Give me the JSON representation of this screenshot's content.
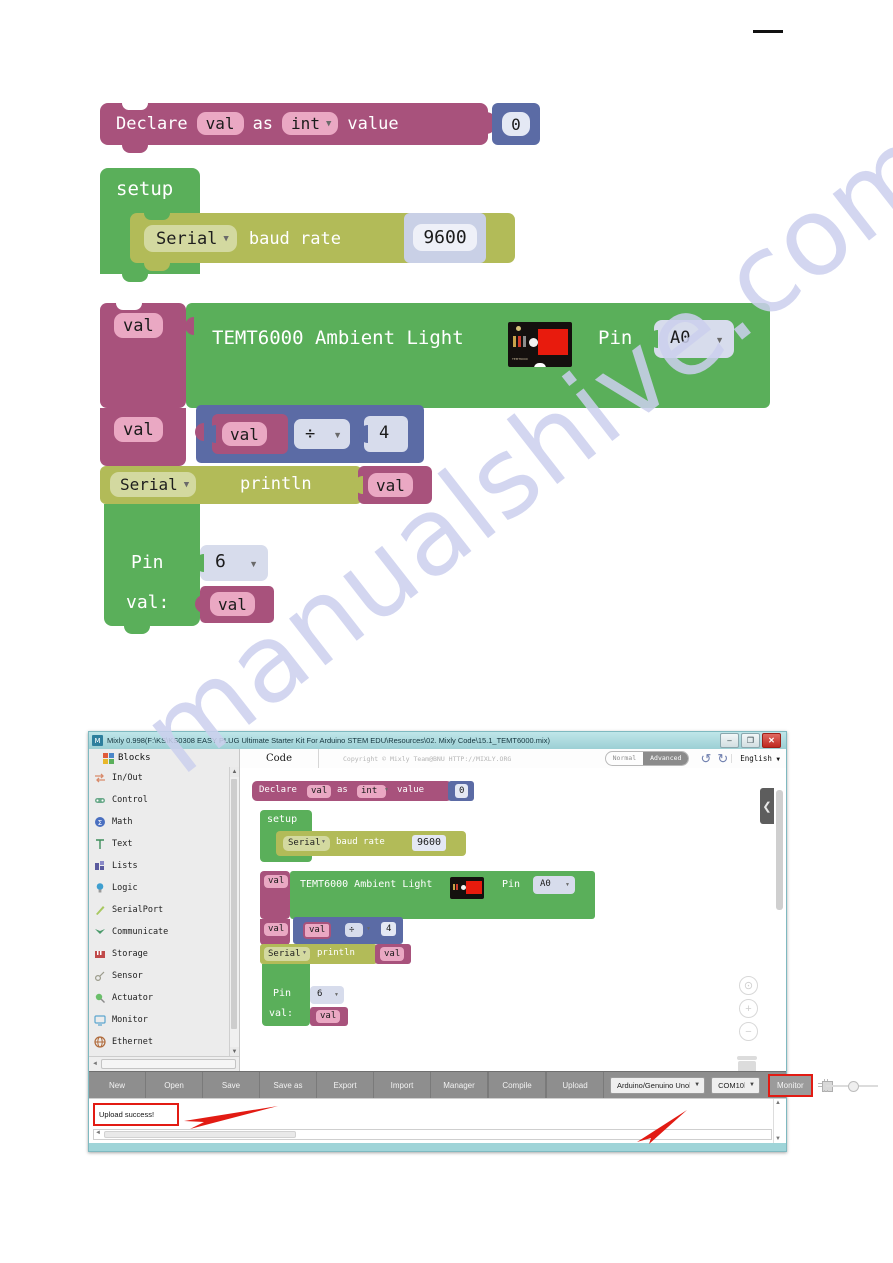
{
  "watermark": "manualshive.com",
  "blocks_diagram": {
    "declare": {
      "label_1": "Declare",
      "var_name": "val",
      "label_2": "as",
      "type": "int",
      "label_3": "value",
      "value": "0"
    },
    "setup": {
      "label": "setup",
      "serial": "Serial",
      "baud_label": "baud rate",
      "baud_value": "9600"
    },
    "sensor_row": {
      "var_name": "val",
      "label": "TEMT6000 Ambient Light",
      "pin_label": "Pin",
      "pin_value": "A0",
      "sensor_silk": "TEMT6000"
    },
    "math_row": {
      "var_name": "val",
      "operand_a": "val",
      "operator": "÷",
      "operand_b": "4"
    },
    "println_row": {
      "serial": "Serial",
      "label": "println",
      "value": "val"
    },
    "analog_row": {
      "pin_label": "Pin",
      "pin_value": "6",
      "val_label": "val:",
      "val_value": "val"
    }
  },
  "app": {
    "title": "Mixly 0.998(F:\\KS\\KS0308 EASY PLUG Ultimate Starter Kit For Arduino STEM EDU\\Resources\\02. Mixly Code\\15.1_TEMT6000.mix)",
    "title_icon": "mixly-icon",
    "window_buttons": {
      "minimize": "–",
      "maximize": "❐",
      "close": "✕"
    },
    "sidebar": {
      "header": "Blocks",
      "items": [
        {
          "label": "In/Out",
          "icon": "inout-icon"
        },
        {
          "label": "Control",
          "icon": "control-icon"
        },
        {
          "label": "Math",
          "icon": "math-icon"
        },
        {
          "label": "Text",
          "icon": "text-icon"
        },
        {
          "label": "Lists",
          "icon": "lists-icon"
        },
        {
          "label": "Logic",
          "icon": "logic-icon"
        },
        {
          "label": "SerialPort",
          "icon": "serialport-icon"
        },
        {
          "label": "Communicate",
          "icon": "communicate-icon"
        },
        {
          "label": "Storage",
          "icon": "storage-icon"
        },
        {
          "label": "Sensor",
          "icon": "sensor-icon"
        },
        {
          "label": "Actuator",
          "icon": "actuator-icon"
        },
        {
          "label": "Monitor",
          "icon": "monitor-icon"
        },
        {
          "label": "Ethernet",
          "icon": "ethernet-icon"
        }
      ]
    },
    "workspace_header": {
      "code_tab": "Code",
      "copyright": "Copyright © Mixly Team@BNU HTTP://MIXLY.ORG",
      "mode_normal": "Normal",
      "mode_advanced": "Advanced",
      "undo_icon": "undo-icon",
      "redo_icon": "redo-icon",
      "language": "English"
    },
    "canvas_controls": {
      "collapse": "❮",
      "center": "⊙",
      "zoom_in": "+",
      "zoom_out": "−",
      "trash": "trash-icon"
    },
    "toolbar": {
      "buttons": [
        "New",
        "Open",
        "Save",
        "Save as",
        "Export",
        "Import",
        "Manager",
        "Compile",
        "Upload"
      ],
      "board": "Arduino/Genuino Uno",
      "port": "COM10",
      "monitor": "Monitor"
    },
    "status": {
      "message": "Upload success!"
    }
  },
  "colors": {
    "variable": "#a8527c",
    "green": "#5aaf5a",
    "olive": "#b2bb58",
    "blue": "#5b6ba5",
    "field": "#d7dcec",
    "highlight_red": "#e21b13",
    "titlebar": "#9ccfd4"
  }
}
